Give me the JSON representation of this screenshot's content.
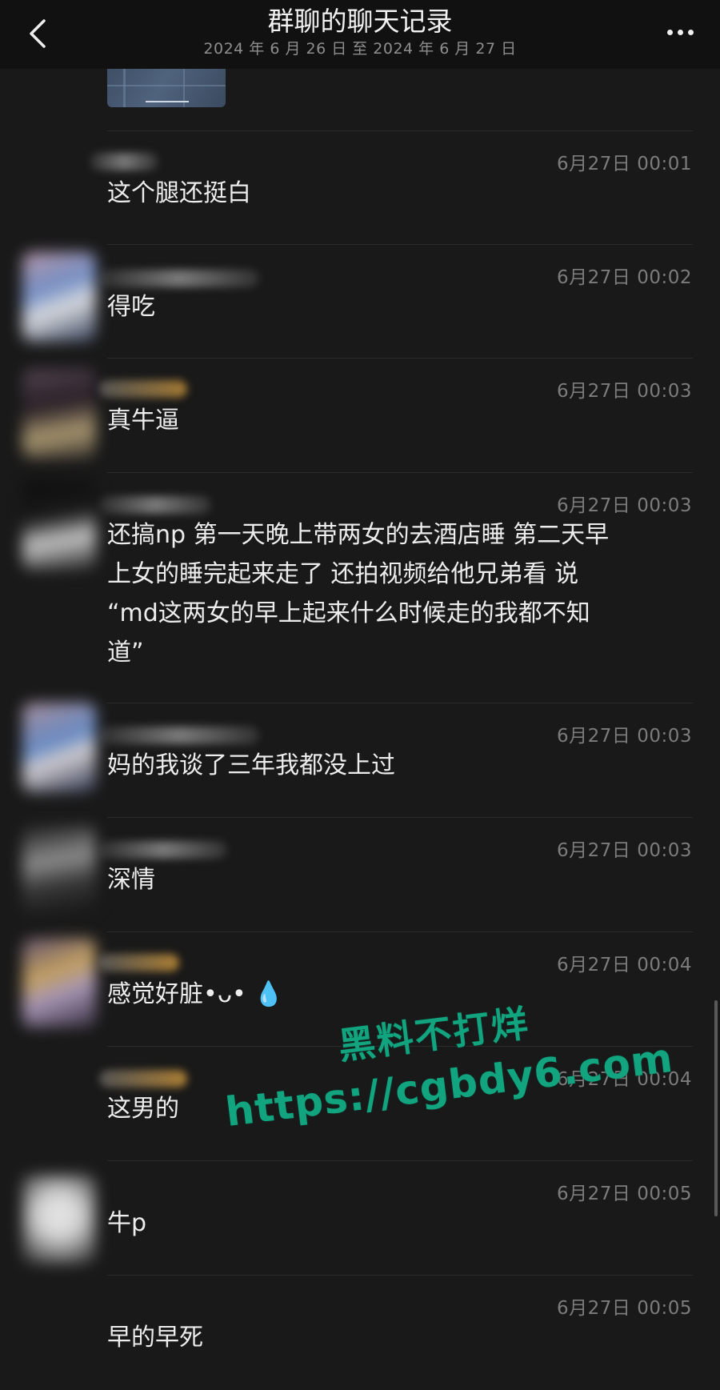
{
  "header": {
    "title": "群聊的聊天记录",
    "date_range": "2024 年 6 月 26 日 至 2024 年 6 月 27 日"
  },
  "messages": [
    {
      "time": "6月27日 00:01",
      "text": "这个腿还挺白"
    },
    {
      "time": "6月27日 00:02",
      "text": "得吃"
    },
    {
      "time": "6月27日 00:03",
      "text": "真牛逼"
    },
    {
      "time": "6月27日 00:03",
      "text": "还搞np 第一天晚上带两女的去酒店睡 第二天早\n上女的睡完起来走了 还拍视频给他兄弟看 说\n“md这两女的早上起来什么时候走的我都不知\n道”"
    },
    {
      "time": "6月27日 00:03",
      "text": "妈的我谈了三年我都没上过"
    },
    {
      "time": "6月27日 00:03",
      "text": "深情"
    },
    {
      "time": "6月27日 00:04",
      "text": "感觉好脏•ᴗ• 💧"
    },
    {
      "time": "6月27日 00:04",
      "text": "这男的"
    },
    {
      "time": "6月27日 00:05",
      "text": "牛p"
    },
    {
      "time": "6月27日 00:05",
      "text": "早的早死"
    }
  ],
  "watermark": {
    "line1": "黑料不打烊",
    "line2": "https://cgbdy6.com"
  },
  "colors": {
    "background": "#191919",
    "topbar": "#111111",
    "timestamp": "#7c7c7c",
    "watermark": "#12a47e"
  },
  "icons": {
    "back": "chevron-left-icon",
    "more": "more-dots-icon"
  }
}
